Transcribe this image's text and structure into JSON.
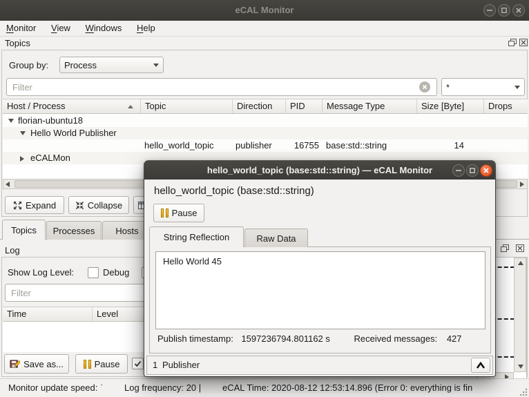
{
  "window": {
    "title": "eCAL Monitor"
  },
  "menu_bar": {
    "items": [
      {
        "accel": "M",
        "rest": "onitor"
      },
      {
        "accel": "V",
        "rest": "iew"
      },
      {
        "accel": "W",
        "rest": "indows"
      },
      {
        "accel": "H",
        "rest": "elp"
      }
    ]
  },
  "topics_panel": {
    "title": "Topics",
    "group_by_label": "Group by:",
    "group_by_value": "Process",
    "filter_placeholder": "Filter",
    "filter_scope_value": "*",
    "table": {
      "columns": [
        "Host / Process",
        "Topic",
        "Direction",
        "PID",
        "Message Type",
        "Size [Byte]",
        "Drops"
      ],
      "rows": [
        {
          "host": "florian-ubuntu18",
          "expanded": true
        },
        {
          "host": "Hello World Publisher",
          "expanded": true
        },
        {
          "topic": "hello_world_topic",
          "direction": "publisher",
          "pid": "16755",
          "message_type": "base:std::string",
          "size": "14",
          "drops": ""
        },
        {
          "host": "eCALMon",
          "expanded": false
        }
      ]
    },
    "expand_button": "Expand",
    "collapse_button": "Collapse"
  },
  "main_tabs": [
    {
      "label": "Topics",
      "selected": true
    },
    {
      "label": "Processes",
      "selected": false
    },
    {
      "label": "Hosts",
      "selected": false
    }
  ],
  "log_panel": {
    "title": "Log",
    "show_log_level_label": "Show Log Level:",
    "debug_checkbox_label": "Debug",
    "filter_placeholder": "Filter",
    "table_columns": [
      "Time",
      "Level"
    ],
    "save_as_button": "Save as...",
    "pause_button": "Pause"
  },
  "dialog": {
    "title": "hello_world_topic (base:std::string) — eCAL Monitor",
    "topic_heading": "hello_world_topic (base:std::string)",
    "pause_button": "Pause",
    "tabs": [
      {
        "label": "String Reflection",
        "selected": true
      },
      {
        "label": "Raw Data",
        "selected": false
      }
    ],
    "message_text": "Hello World 45",
    "publish_timestamp_label": "Publish timestamp:",
    "publish_timestamp_value": "1597236794.801162 s",
    "received_messages_label": "Received messages:",
    "received_messages_value": "427",
    "publisher_count": "1",
    "publisher_label": "Publisher"
  },
  "status_bar": {
    "segments": [
      "Monitor update speed: ˈ",
      "Log frequency: 20 |",
      "eCAL Time: 2020-08-12 12:53:14.896 (Error 0: everything is fin"
    ]
  },
  "colors": {
    "titlebar": "#3c3b37",
    "close_button_active": "#e95420",
    "pause_icon": "#f2b21b",
    "panel_bg": "#f2f1f0"
  }
}
